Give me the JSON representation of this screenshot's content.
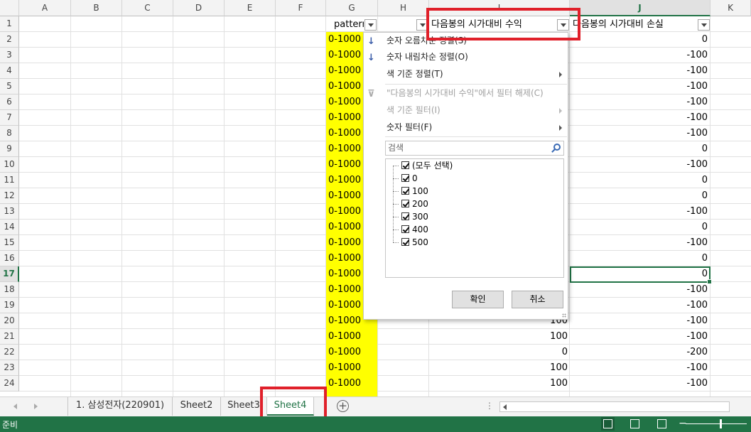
{
  "columns": [
    "A",
    "B",
    "C",
    "D",
    "E",
    "F",
    "G",
    "H",
    "I",
    "J",
    "K"
  ],
  "rows": [
    "1",
    "2",
    "3",
    "4",
    "5",
    "6",
    "7",
    "8",
    "9",
    "10",
    "11",
    "12",
    "13",
    "14",
    "15",
    "16",
    "17",
    "18",
    "19",
    "20",
    "21",
    "22",
    "23",
    "24"
  ],
  "headers": {
    "g": "pattern",
    "i": "다음봉의 시가대비 수익",
    "j": "다음봉의 시가대비 손실"
  },
  "g_values": [
    "0-1000",
    "0-1000",
    "0-1000",
    "0-1000",
    "0-1000",
    "0-1000",
    "0-1000",
    "0-1000",
    "0-1000",
    "0-1000",
    "0-1000",
    "0-1000",
    "0-1000",
    "0-1000",
    "0-1000",
    "0-1000",
    "0-1000",
    "0-1000",
    "0-1000",
    "0-1000",
    "0-1000",
    "0-1000",
    "0-1000"
  ],
  "i_values": {
    "r20": "100",
    "r21": "100",
    "r22": "0",
    "r23": "100",
    "r24": "100"
  },
  "j_values": [
    "0",
    "-100",
    "-100",
    "-100",
    "-100",
    "-100",
    "-100",
    "0",
    "-100",
    "0",
    "0",
    "-100",
    "0",
    "-100",
    "0",
    "0",
    "-100",
    "-100",
    "-100",
    "-100",
    "-200",
    "-100",
    "-100"
  ],
  "filter_menu": {
    "sort_asc": "숫자 오름차순 정렬(S)",
    "sort_desc": "숫자 내림차순 정렬(O)",
    "sort_color": "색 기준 정렬(T)",
    "clear_filter": "\"다음봉의 시가대비 수익\"에서 필터 해제(C)",
    "color_filter": "색 기준 필터(I)",
    "number_filter": "숫자 필터(F)",
    "search_placeholder": "검색",
    "items": [
      "(모두 선택)",
      "0",
      "100",
      "200",
      "300",
      "400",
      "500"
    ],
    "ok": "확인",
    "cancel": "취소"
  },
  "tabs": [
    "1. 삼성전자(220901)",
    "Sheet2",
    "Sheet3",
    "Sheet4"
  ],
  "active_tab": "Sheet4",
  "status": "준비",
  "colors": {
    "accent": "#217346",
    "highlight": "#ffff00",
    "annotation": "#e0202a"
  }
}
